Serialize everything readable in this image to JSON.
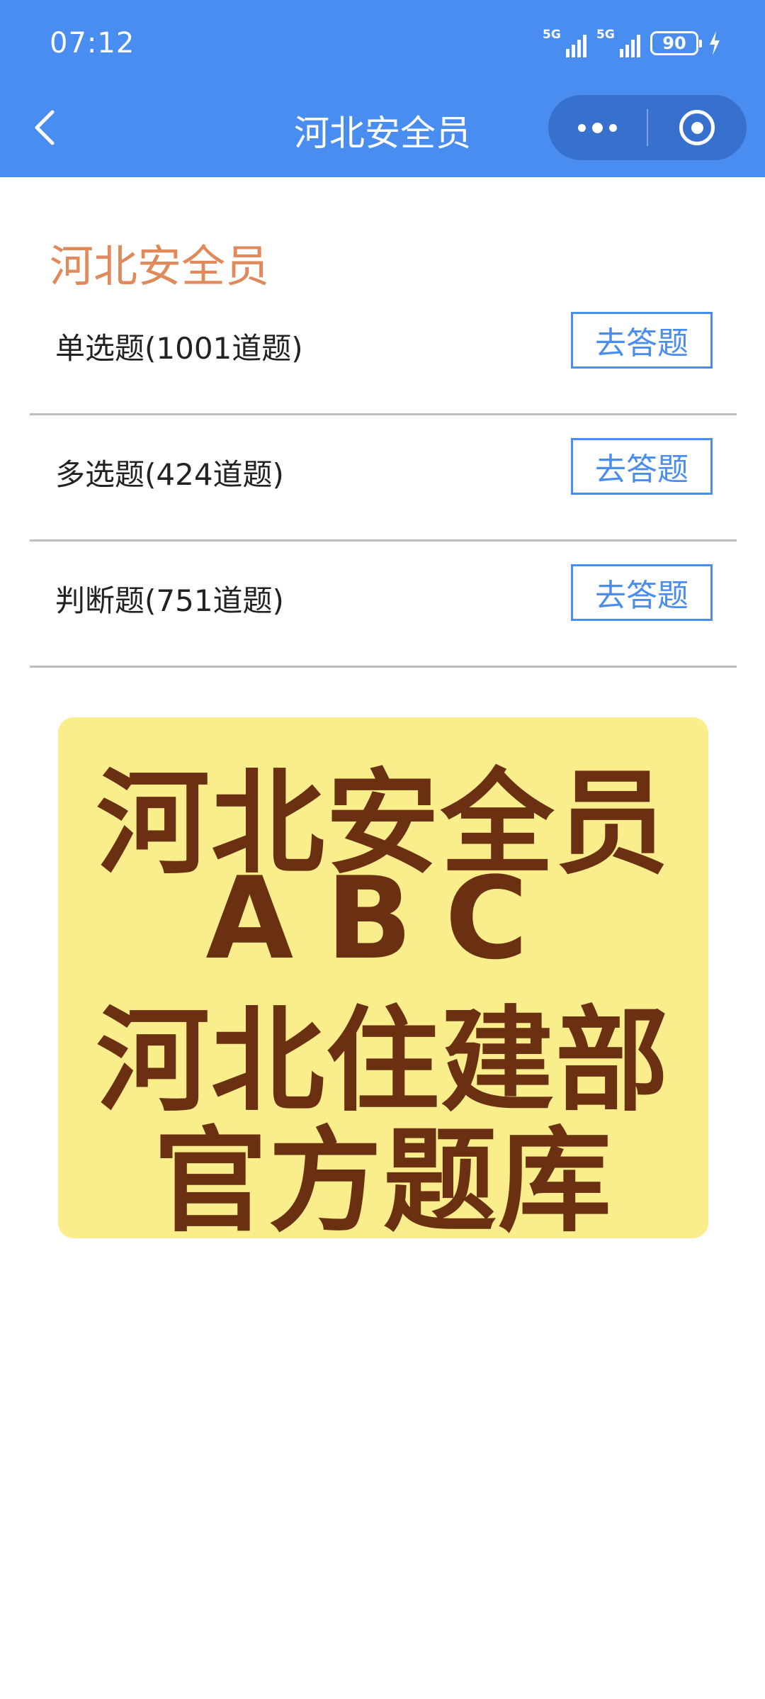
{
  "status_bar": {
    "time": "07:12",
    "network_1": "5G",
    "network_2": "5G",
    "battery": "90"
  },
  "nav_bar": {
    "title": "河北安全员",
    "back_icon": "chevron-left-icon",
    "more_icon": "more-dots-icon",
    "close_icon": "record-circle-icon"
  },
  "section": {
    "title": "河北安全员",
    "items": [
      {
        "label": "单选题(1001道题)",
        "button": "去答题"
      },
      {
        "label": "多选题(424道题)",
        "button": "去答题"
      },
      {
        "label": "判断题(751道题)",
        "button": "去答题"
      }
    ]
  },
  "promo": {
    "lines": [
      "河北安全员",
      "ABC",
      "河北住建部",
      "官方题库"
    ]
  },
  "colors": {
    "header_bg": "#4a8df0",
    "section_title": "#e08a5c",
    "button": "#4a8df0",
    "promo_bg": "#f9ed8c",
    "promo_text": "#6b2f12"
  }
}
